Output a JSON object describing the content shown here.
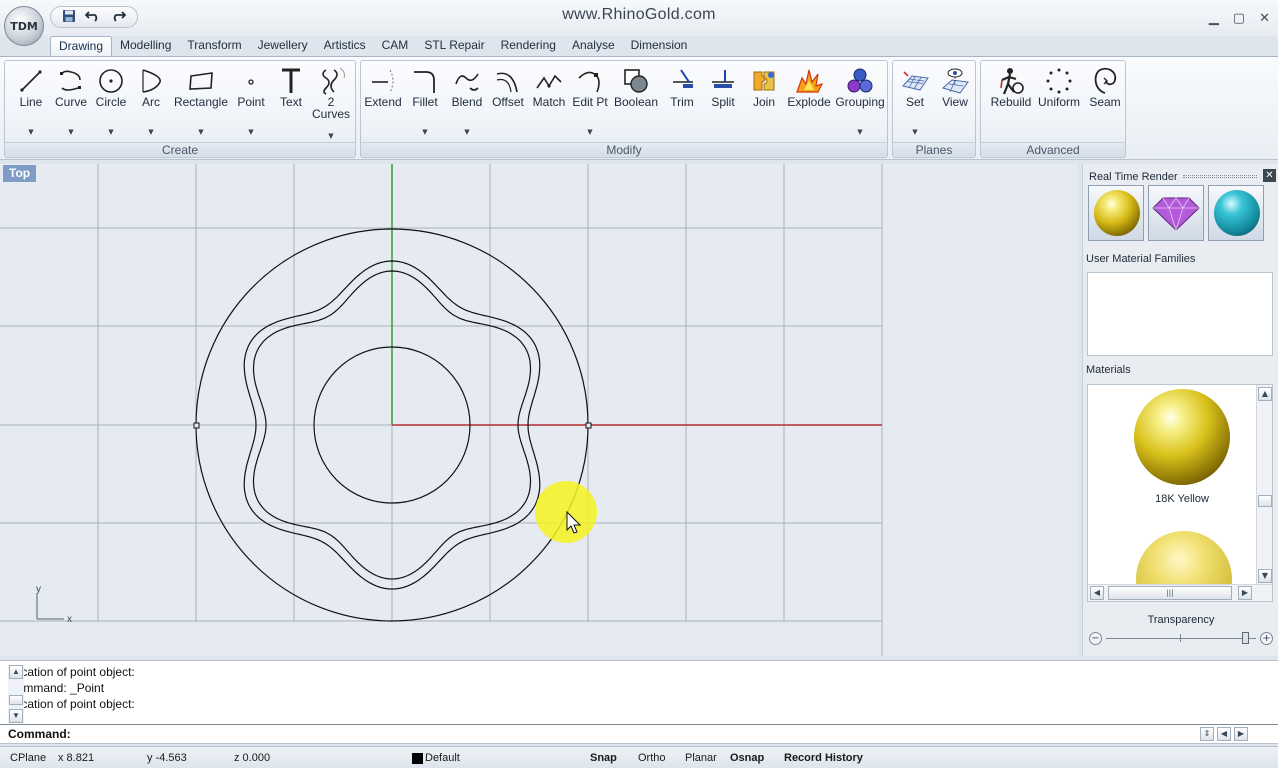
{
  "app": {
    "title": "www.RhinoGold.com",
    "logo_text": "TDM",
    "quick_access": {
      "save_icon": "save-icon",
      "undo_icon": "undo-icon",
      "redo_icon": "redo-icon"
    },
    "window_controls": {
      "minimize": "▁",
      "restore": "▢",
      "close": "✕"
    }
  },
  "tabs": [
    "Drawing",
    "Modelling",
    "Transform",
    "Jewellery",
    "Artistics",
    "CAM",
    "STL Repair",
    "Rendering",
    "Analyse",
    "Dimension"
  ],
  "active_tab": "Drawing",
  "ribbon": {
    "groups": {
      "create": {
        "label": "Create",
        "buttons": {
          "line": {
            "label": "Line",
            "icon": "line-icon"
          },
          "curve": {
            "label": "Curve",
            "icon": "curve-icon"
          },
          "circle": {
            "label": "Circle",
            "icon": "circle-icon"
          },
          "arc": {
            "label": "Arc",
            "icon": "arc-icon"
          },
          "rectangle": {
            "label": "Rectangle",
            "icon": "rectangle-icon"
          },
          "point": {
            "label": "Point",
            "icon": "point-icon"
          },
          "text": {
            "label": "Text",
            "icon": "text-icon"
          },
          "two_curves": {
            "label": "2",
            "label2": "Curves",
            "icon": "two-curves-icon"
          }
        }
      },
      "modify": {
        "label": "Modify",
        "buttons": {
          "extend": {
            "label": "Extend"
          },
          "fillet": {
            "label": "Fillet"
          },
          "blend": {
            "label": "Blend"
          },
          "offset": {
            "label": "Offset"
          },
          "match": {
            "label": "Match"
          },
          "editpt": {
            "label": "Edit Pt"
          },
          "boolean": {
            "label": "Boolean"
          },
          "trim": {
            "label": "Trim"
          },
          "split": {
            "label": "Split"
          },
          "join": {
            "label": "Join"
          },
          "explode": {
            "label": "Explode"
          },
          "grouping": {
            "label": "Grouping"
          }
        }
      },
      "planes": {
        "label": "Planes",
        "buttons": {
          "set": {
            "label": "Set"
          },
          "view": {
            "label": "View"
          }
        }
      },
      "advanced": {
        "label": "Advanced",
        "buttons": {
          "rebuild": {
            "label": "Rebuild"
          },
          "uniform": {
            "label": "Uniform"
          },
          "seam": {
            "label": "Seam"
          }
        }
      }
    }
  },
  "viewport": {
    "label": "Top",
    "axis_y": "y",
    "axis_x": "x",
    "colors": {
      "x_axis": "#b03030",
      "y_axis": "#2a9a2a",
      "grid": "#a8b2bd",
      "curve": "#111111",
      "background": "#e6ebf1",
      "highlight": "#f5f31e"
    }
  },
  "panel": {
    "real_time_render": "Real Time Render",
    "render_thumbs": [
      "gold-sphere",
      "purple-gem",
      "teal-sphere"
    ],
    "user_material_families": "User Material Families",
    "materials_label": "Materials",
    "materials": [
      {
        "name": "18K Yellow",
        "color": "#d9c21b"
      },
      {
        "name": "",
        "color": "#e8d45a"
      }
    ],
    "transparency_label": "Transparency",
    "transparency_value": 0.95
  },
  "command": {
    "history": [
      "Location of point object:",
      "Command: _Point",
      "Location of point object:"
    ],
    "prompt": "Command:",
    "input_value": ""
  },
  "status": {
    "cplane": "CPlane",
    "x": "x 8.821",
    "y": "y -4.563",
    "z": "z 0.000",
    "layer": "Default",
    "layer_color": "#000000",
    "snap": "Snap",
    "ortho": "Ortho",
    "planar": "Planar",
    "osnap": "Osnap",
    "record_history": "Record History"
  }
}
